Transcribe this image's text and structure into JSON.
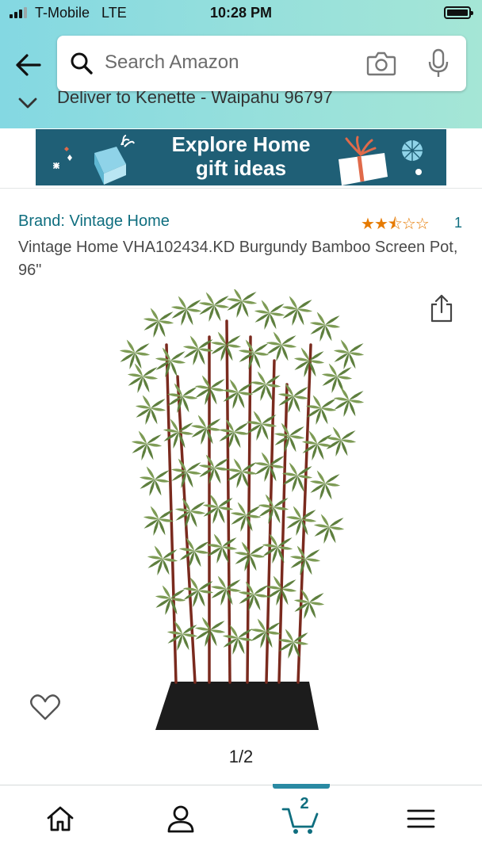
{
  "status_bar": {
    "carrier": "T-Mobile",
    "network": "LTE",
    "time": "10:28 PM"
  },
  "header": {
    "search_placeholder": "Search Amazon",
    "deliver_text": "Deliver to Kenette - Waipahu 96797"
  },
  "banner": {
    "line1": "Explore Home",
    "line2": "gift ideas"
  },
  "product": {
    "brand": "Brand: Vintage Home",
    "rating_stars": 2.5,
    "rating_count": "1",
    "title": "Vintage Home VHA102434.KD Burgundy Bamboo Screen Pot, 96\"",
    "image_counter": "1/2"
  },
  "tab_bar": {
    "items": [
      {
        "name": "home",
        "icon": "home-icon"
      },
      {
        "name": "account",
        "icon": "person-icon"
      },
      {
        "name": "cart",
        "icon": "cart-icon"
      },
      {
        "name": "menu",
        "icon": "menu-icon"
      }
    ],
    "cart_count": "2",
    "active": "cart"
  },
  "colors": {
    "header_gradient_start": "#84d8e2",
    "header_gradient_end": "#a5e6d6",
    "banner_bg": "#1f5f76",
    "link": "#0f6e7f",
    "star": "#e67a00",
    "tab_indicator": "#2a8aa3"
  }
}
